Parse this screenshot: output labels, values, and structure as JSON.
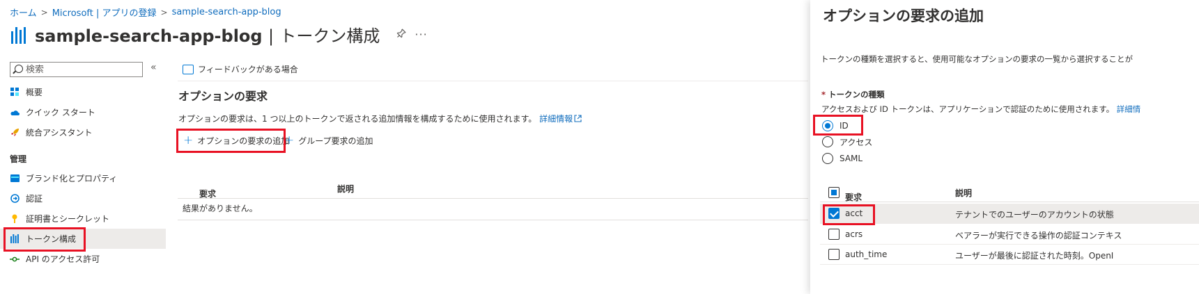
{
  "breadcrumb": {
    "items": [
      "ホーム",
      "Microsoft | アプリの登録",
      "sample-search-app-blog"
    ],
    "separator": ">"
  },
  "header": {
    "app_name": "sample-search-app-blog",
    "separator": "|",
    "page_name": "トークン構成",
    "pin": "✎",
    "more": "···"
  },
  "sidebar": {
    "search_placeholder": "検索",
    "collapse": "«",
    "section_manage": "管理",
    "items": [
      {
        "label": "概要",
        "icon": "grid-icon"
      },
      {
        "label": "クイック スタート",
        "icon": "cloud-icon"
      },
      {
        "label": "統合アシスタント",
        "icon": "rocket-icon"
      },
      {
        "label": "ブランド化とプロパティ",
        "icon": "branding-icon"
      },
      {
        "label": "認証",
        "icon": "auth-icon"
      },
      {
        "label": "証明書とシークレット",
        "icon": "key-icon"
      },
      {
        "label": "トークン構成",
        "icon": "token-icon"
      },
      {
        "label": "API のアクセス許可",
        "icon": "api-icon"
      }
    ]
  },
  "main": {
    "feedback": "フィードバックがある場合",
    "section_title": "オプションの要求",
    "description": "オプションの要求は、1 つ以上のトークンで返される追加情報を構成するために使用されます。",
    "more_info": "詳細情報",
    "add_optional": "オプションの要求の追加",
    "add_group": "グループ要求の追加",
    "col_claim": "要求",
    "col_desc": "説明",
    "empty": "結果がありません。"
  },
  "panel": {
    "title": "オプションの要求の追加",
    "description": "トークンの種類を選択すると、使用可能なオプションの要求の一覧から選択することが",
    "token_type_label": "トークンの種類",
    "required_mark": "*",
    "token_type_desc": "アクセスおよび ID トークンは、アプリケーションで認証のために使用されます。",
    "token_type_link": "詳細情",
    "options": [
      "ID",
      "アクセス",
      "SAML"
    ],
    "selected_option": "ID",
    "col_claim": "要求",
    "col_desc": "説明",
    "rows": [
      {
        "name": "acct",
        "desc": "テナントでのユーザーのアカウントの状態",
        "checked": true
      },
      {
        "name": "acrs",
        "desc": "ベアラーが実行できる操作の認証コンテキス",
        "checked": false
      },
      {
        "name": "auth_time",
        "desc": "ユーザーが最後に認証された時刻。OpenI",
        "checked": false
      }
    ]
  },
  "colors": {
    "accent": "#0078d4",
    "highlight": "#e81123",
    "link": "#0f6cbd"
  }
}
